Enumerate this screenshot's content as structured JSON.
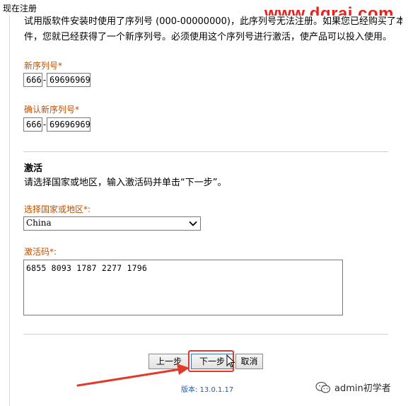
{
  "window": {
    "title": "现在注册"
  },
  "watermark": {
    "text": "www.dgrai.com"
  },
  "intro": {
    "line1": "试用版软件安装时使用了序列号 (000-00000000)，此序列号无法注册。如果您已经购买了本软",
    "line2": "件，您就已经获得了一个新序列号。必须使用这个序列号进行激活，使产品可以投入使用。"
  },
  "serial": {
    "label": "新序列号*",
    "prefix": "666",
    "separator": "-",
    "number": "69696969"
  },
  "confirm_serial": {
    "label": "确认新序列号*",
    "prefix": "666",
    "separator": "-",
    "number": "69696969"
  },
  "activation": {
    "title": "激活",
    "description": "请选择国家或地区，输入激活码并单击“下一步”。",
    "country_label": "选择国家或地区*:",
    "country_value": "China",
    "code_label": "激活码*:",
    "code_value": "6855 8093 1787 2277 1796"
  },
  "buttons": {
    "back": "上一步",
    "next": "下一步",
    "cancel": "取消"
  },
  "version": {
    "text": "版本: 13.0.1.17"
  },
  "brand": {
    "text": "admin初学者"
  },
  "colors": {
    "label_orange": "#c05000",
    "highlight_red": "#e23a2a",
    "version_blue": "#1d5aa8",
    "watermark_red": "#e8221a"
  }
}
